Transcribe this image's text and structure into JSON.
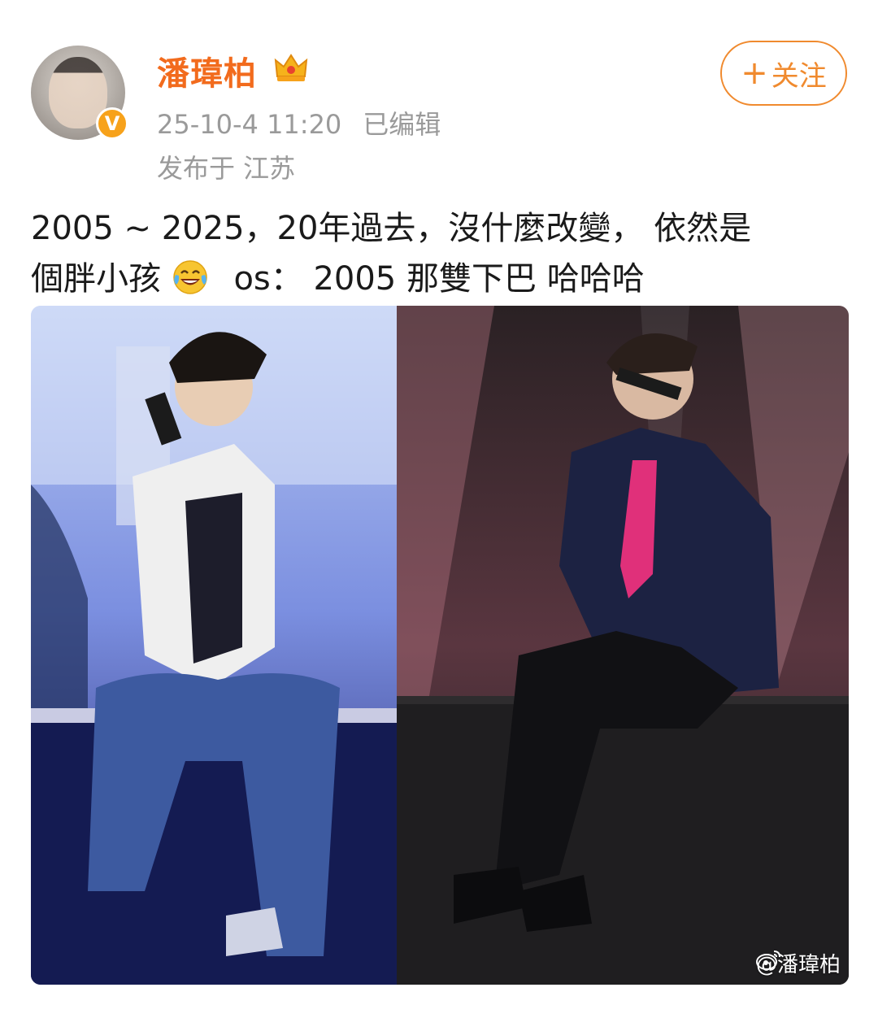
{
  "header": {
    "username": "潘瑋柏",
    "timestamp": "25-10-4 11:20",
    "edited_label": "已编辑",
    "location": "发布于 江苏",
    "follow_label": "关注",
    "verified_icon": "verified-badge-icon",
    "crown_icon": "crown-icon"
  },
  "post": {
    "line1": "2005 ~ 2025，20年過去，沒什麼改變， 依然是",
    "line2_a": "個胖小孩",
    "line2_b": "os： 2005 那雙下巴 哈哈哈",
    "emoji": "laughing-crying-emoji"
  },
  "media": {
    "watermark": "@潘瑋柏",
    "left_photo": "2005 concert photo",
    "right_photo": "2025 concert photo"
  },
  "colors": {
    "accent": "#f26b1d",
    "follow": "#f08a2e",
    "meta": "#9a9a9a"
  }
}
